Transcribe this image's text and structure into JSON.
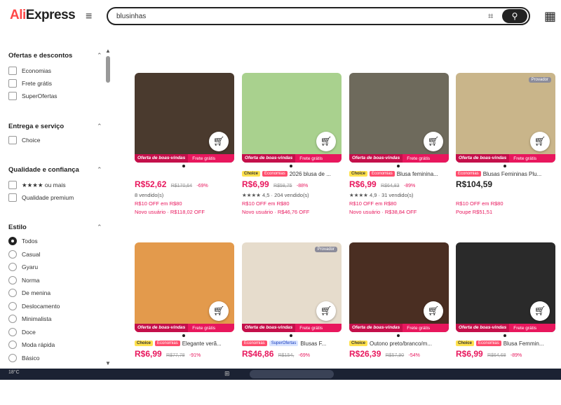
{
  "header": {
    "logo_part1": "Ali",
    "logo_part2": "Express",
    "search_value": "blusinhas"
  },
  "icons": {
    "menu": "hamburger-icon",
    "camera": "camera-search-icon",
    "search": "search-icon",
    "qr": "qr-code-icon",
    "cart": "cart-icon"
  },
  "sidebar": {
    "sections": [
      {
        "title": "Ofertas e descontos",
        "options": [
          "Economias",
          "Frete grátis",
          "SuperOfertas"
        ]
      },
      {
        "title": "Entrega e serviço",
        "options": [
          "Choice"
        ]
      },
      {
        "title": "Qualidade e confiança",
        "options": [
          "★★★★ ou mais",
          "Qualidade premium"
        ]
      },
      {
        "title": "Estilo",
        "options": [
          "Todos",
          "Casual",
          "Gyaru",
          "Norma",
          "De menina",
          "Deslocamento",
          "Minimalista",
          "Doce",
          "Moda rápida",
          "Básico"
        ]
      }
    ]
  },
  "banner": {
    "deal": "Oferta de boas-vindas",
    "shipping": "Frete grátis"
  },
  "products": [
    {
      "title": "",
      "badges": [],
      "price": "R$52,62",
      "old": "R$170,64",
      "disc": "-69%",
      "sold": "8 vendido(s)",
      "coupon": "R$10 OFF em R$80",
      "novo": "Novo usuário · R$118,02 OFF",
      "tag": "",
      "color": "#4a3a2e"
    },
    {
      "title": "2026 blusa de ...",
      "badges": [
        "Choice",
        "Economias"
      ],
      "price": "R$6,99",
      "old": "R$58,75",
      "disc": "-88%",
      "sold": "★★★★ 4,5 · 204 vendido(s)",
      "coupon": "R$10 OFF em R$80",
      "novo": "Novo usuário · R$46,76 OFF",
      "tag": "",
      "color": "#a9d18e"
    },
    {
      "title": "Blusa feminina...",
      "badges": [
        "Choice",
        "Economias"
      ],
      "price": "R$6,99",
      "old": "R$64,83",
      "disc": "-89%",
      "sold": "★★★★ 4,9 · 31 vendido(s)",
      "coupon": "R$10 OFF em R$80",
      "novo": "Novo usuário · R$38,84 OFF",
      "tag": "",
      "color": "#6e6a5c"
    },
    {
      "title": "Blusas Femininas Plu...",
      "badges": [
        "Economias"
      ],
      "price": "R$104,59",
      "old": "",
      "disc": "",
      "sold": "",
      "coupon": "R$10 OFF em R$80",
      "novo": "Poupe R$51,51",
      "tag": "Provador",
      "color": "#c9b58a",
      "dark": true
    },
    {
      "title": "Elegante verã...",
      "badges": [
        "Choice",
        "Economias"
      ],
      "price": "R$6,99",
      "old": "R$77,78",
      "disc": "-91%",
      "sold": "",
      "coupon": "",
      "novo": "",
      "tag": "",
      "color": "#e39a4c"
    },
    {
      "title": "Blusas F...",
      "badges": [
        "Economias",
        "SuperOfertas"
      ],
      "price": "R$46,86",
      "old": "R$154,",
      "disc": "-69%",
      "sold": "",
      "coupon": "",
      "novo": "",
      "tag": "Provador",
      "color": "#e6dccc"
    },
    {
      "title": "Outono preto/branco/m...",
      "badges": [
        "Choice"
      ],
      "price": "R$26,39",
      "old": "R$57,90",
      "disc": "-54%",
      "sold": "",
      "coupon": "",
      "novo": "",
      "tag": "",
      "color": "#4a2e22"
    },
    {
      "title": "Blusa Femmin...",
      "badges": [
        "Choice",
        "Economias"
      ],
      "price": "R$6,99",
      "old": "R$64,68",
      "disc": "-89%",
      "sold": "",
      "coupon": "",
      "novo": "",
      "tag": "",
      "color": "#2a2a2a"
    }
  ],
  "taskbar": {
    "weather": "18°C"
  }
}
